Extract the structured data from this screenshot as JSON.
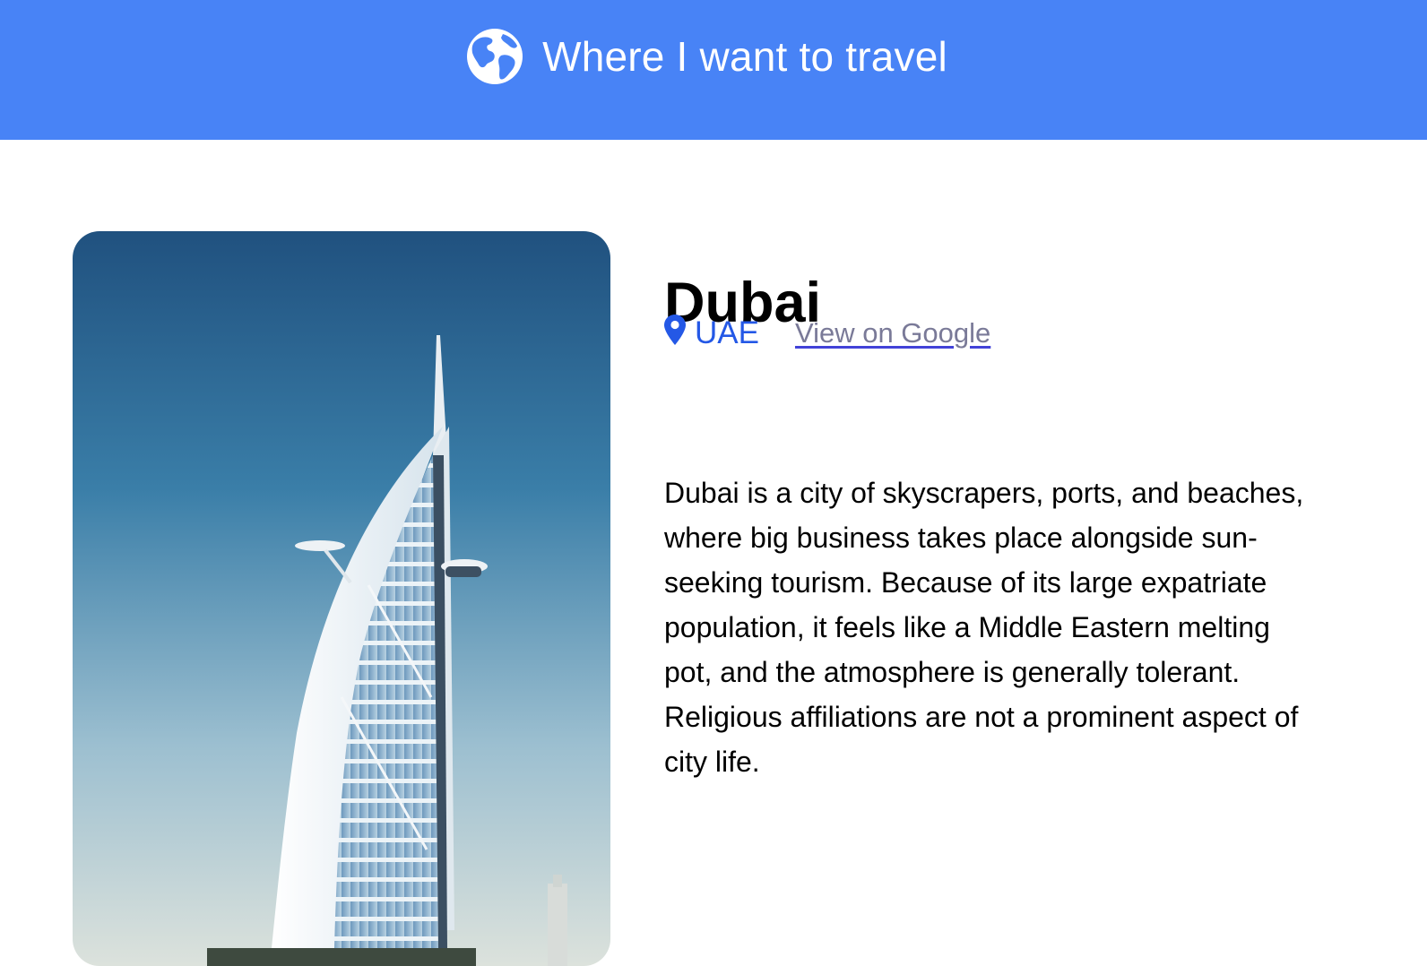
{
  "header": {
    "title": "Where I want to travel",
    "icon": "globe-icon",
    "background": "#4883f6"
  },
  "destination": {
    "image_alt": "Burj Al Arab skyscraper in Dubai",
    "city": "Dubai",
    "country_icon": "location-pin-icon",
    "country": "UAE",
    "map_link_label": "View on Google",
    "description": "Dubai is a city of skyscrapers, ports, and beaches, where big business takes place alongside sun-seeking tourism. Because of its large expatriate population, it feels like a Middle Eastern melting pot, and the atmosphere is generally tolerant. Religious affiliations are not a prominent aspect of city life."
  },
  "colors": {
    "accent": "#2458e6",
    "link": "#7a7a98"
  }
}
